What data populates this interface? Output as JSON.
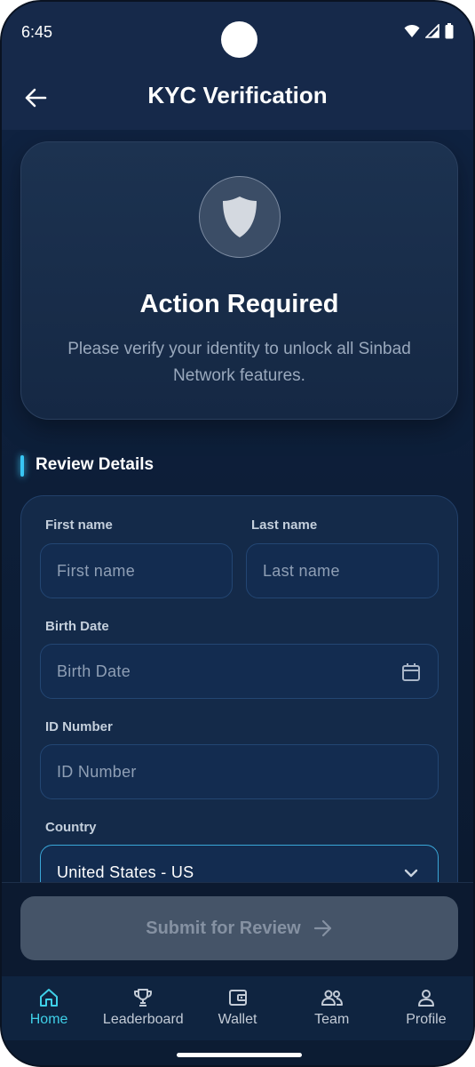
{
  "status_bar": {
    "time": "6:45"
  },
  "app_bar": {
    "title": "KYC Verification"
  },
  "hero": {
    "title": "Action Required",
    "text": "Please verify your identity to unlock all Sinbad Network features."
  },
  "section": {
    "title": "Review Details"
  },
  "form": {
    "first_name": {
      "label": "First name",
      "placeholder": "First name"
    },
    "last_name": {
      "label": "Last name",
      "placeholder": "Last name"
    },
    "birth_date": {
      "label": "Birth Date",
      "placeholder": "Birth Date"
    },
    "id_number": {
      "label": "ID Number",
      "placeholder": "ID Number"
    },
    "country": {
      "label": "Country",
      "value": "United States - US"
    }
  },
  "submit": {
    "label": "Submit for Review"
  },
  "nav": {
    "items": [
      {
        "label": "Home",
        "icon": "home-icon"
      },
      {
        "label": "Leaderboard",
        "icon": "trophy-icon"
      },
      {
        "label": "Wallet",
        "icon": "wallet-icon"
      },
      {
        "label": "Team",
        "icon": "team-icon"
      },
      {
        "label": "Profile",
        "icon": "profile-icon"
      }
    ],
    "active": "Home"
  },
  "colors": {
    "background": "#0c1c33",
    "header": "#16294a",
    "accent": "#3fd0e8",
    "field": "#132c50",
    "submit_disabled": "#455468"
  }
}
